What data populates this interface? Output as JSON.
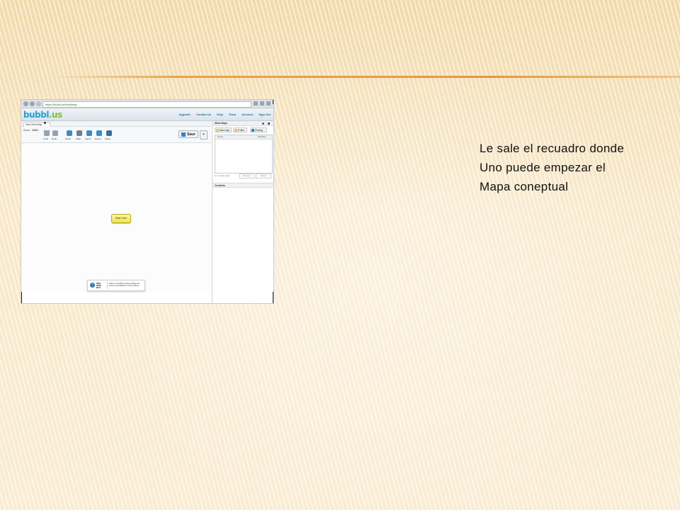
{
  "caption": {
    "line1": "Le sale el recuadro donde",
    "line2": "Uno puede empezar el",
    "line3": "Mapa coneptual"
  },
  "browser": {
    "url": "https://bubbl.us/mindmap"
  },
  "app": {
    "logo_main": "bubbl",
    "logo_suffix": ".us",
    "nav": [
      "Upgrade",
      "Contact Us",
      "Help",
      "Team",
      "Account",
      "Sign Out"
    ]
  },
  "tab": {
    "label": "New Mind Map"
  },
  "toolbar": {
    "zoom_label": "Zoom",
    "zoom_value": "100%",
    "undo": "Undo",
    "fixed_label": "Fixed",
    "redo": "Redo",
    "tools": [
      "Select",
      "Wrap",
      "Import",
      "Export",
      "Share"
    ],
    "save_label": "Save",
    "save_dropdown": "▾"
  },
  "canvas": {
    "start_node": "Start Here",
    "hint_title": "NEW MIND MAP",
    "hint_text": "Click on a bubble to begin editing text. Hover over bubbles for more options."
  },
  "sidebar": {
    "mind_maps_title": "Mind Maps",
    "buttons": [
      "Mind map",
      "Folder",
      "Sharing"
    ],
    "col_name": "Name",
    "col_modified": "Modified",
    "usage": "0 / 3 mind maps",
    "rename": "Rename",
    "delete": "Delete",
    "contacts_title": "Contacts"
  },
  "colors": {
    "background": "#f7e6c4",
    "divider": "#e29a3c",
    "logo_blue": "#2b9fd9",
    "logo_green": "#7fbf3f",
    "node_yellow": "#efe64f"
  }
}
